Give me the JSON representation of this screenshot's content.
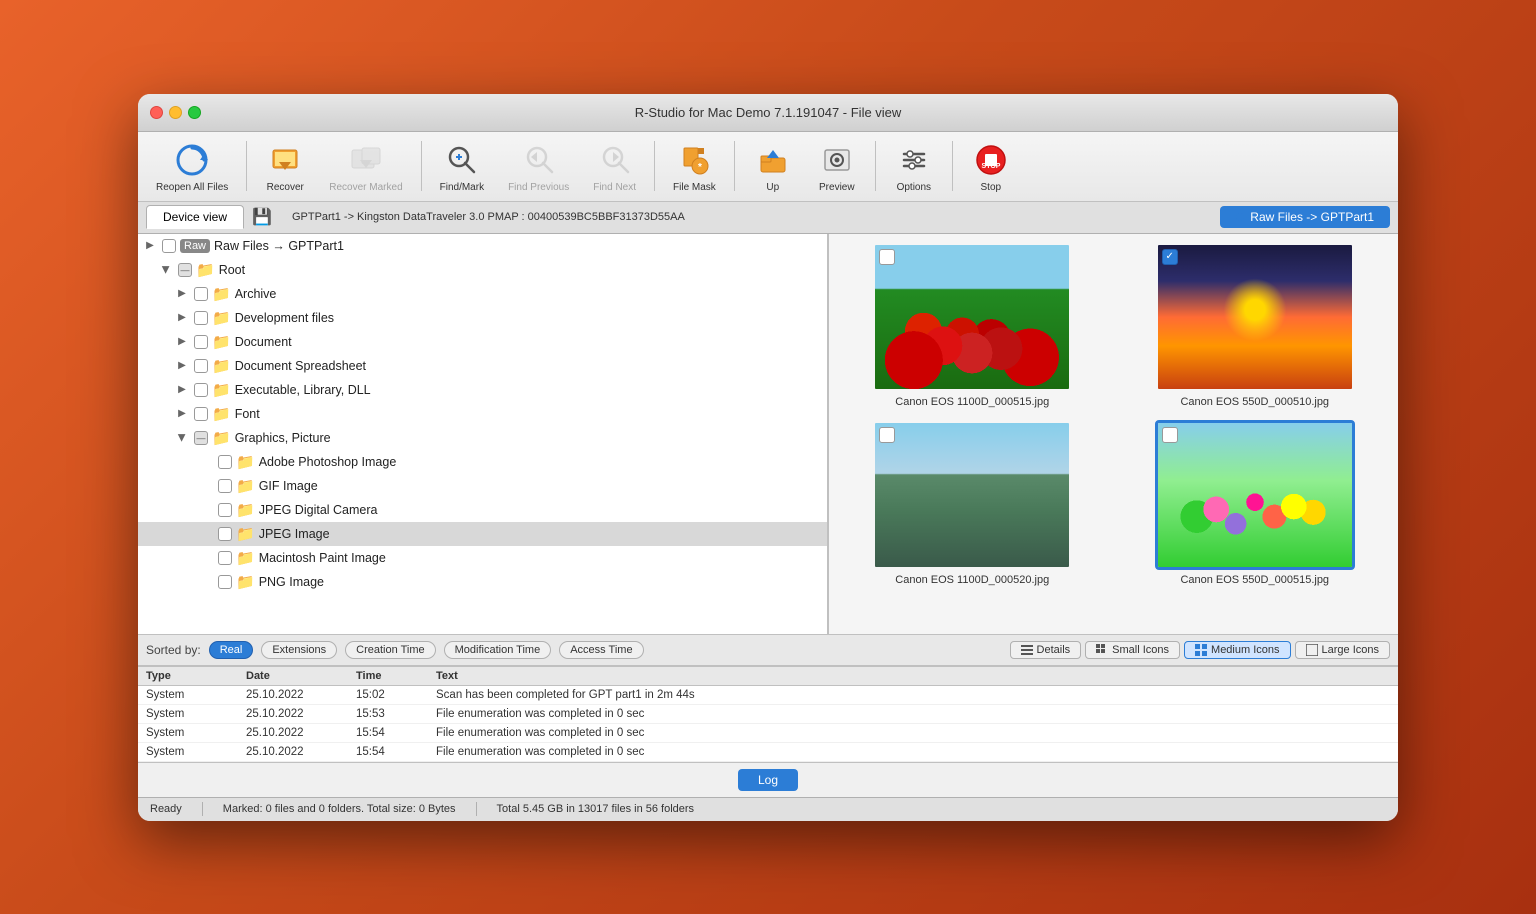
{
  "window": {
    "title": "R-Studio for Mac Demo 7.1.191047 - File view"
  },
  "titlebar": {
    "title": "R-Studio for Mac Demo 7.1.191047 - File view"
  },
  "toolbar": {
    "buttons": [
      {
        "id": "reopen-all-files",
        "label": "Reopen All Files",
        "icon": "↺",
        "disabled": false
      },
      {
        "id": "recover",
        "label": "Recover",
        "icon": "📤",
        "disabled": false
      },
      {
        "id": "recover-marked",
        "label": "Recover Marked",
        "icon": "📦",
        "disabled": false
      },
      {
        "id": "find-mark",
        "label": "Find/Mark",
        "icon": "🔍",
        "disabled": false
      },
      {
        "id": "find-previous",
        "label": "Find Previous",
        "icon": "🔍",
        "disabled": false
      },
      {
        "id": "find-next",
        "label": "Find Next",
        "icon": "🔍",
        "disabled": false
      },
      {
        "id": "file-mask",
        "label": "File Mask",
        "icon": "🎭",
        "disabled": false
      },
      {
        "id": "up",
        "label": "Up",
        "icon": "📂",
        "disabled": false
      },
      {
        "id": "preview",
        "label": "Preview",
        "icon": "👁",
        "disabled": false
      },
      {
        "id": "options",
        "label": "Options",
        "icon": "⚙",
        "disabled": false
      },
      {
        "id": "stop",
        "label": "Stop",
        "icon": "🛑",
        "disabled": false
      }
    ]
  },
  "tabbar": {
    "device_view_label": "Device view",
    "breadcrumb": "GPTPart1 -> Kingston DataTraveler 3.0 PMAP : 00400539BC5BBF31373D55AA",
    "raw_files_tab": "Raw Files -> GPTPart1"
  },
  "sidebar": {
    "root_label": "Raw Files → GPTPart1",
    "tree_items": [
      {
        "id": "root",
        "label": "Root",
        "level": 1,
        "expanded": true,
        "checked": false,
        "indeterminate": true
      },
      {
        "id": "archive",
        "label": "Archive",
        "level": 2,
        "expanded": false,
        "checked": false
      },
      {
        "id": "development-files",
        "label": "Development files",
        "level": 2,
        "expanded": false,
        "checked": false
      },
      {
        "id": "document",
        "label": "Document",
        "level": 2,
        "expanded": false,
        "checked": false
      },
      {
        "id": "document-spreadsheet",
        "label": "Document Spreadsheet",
        "level": 2,
        "expanded": false,
        "checked": false
      },
      {
        "id": "executable-library-dll",
        "label": "Executable, Library, DLL",
        "level": 2,
        "expanded": false,
        "checked": false
      },
      {
        "id": "font",
        "label": "Font",
        "level": 2,
        "expanded": false,
        "checked": false
      },
      {
        "id": "graphics-picture",
        "label": "Graphics, Picture",
        "level": 2,
        "expanded": true,
        "checked": false,
        "indeterminate": true
      },
      {
        "id": "adobe-photoshop-image",
        "label": "Adobe Photoshop Image",
        "level": 3,
        "checked": false
      },
      {
        "id": "gif-image",
        "label": "GIF Image",
        "level": 3,
        "checked": false
      },
      {
        "id": "jpeg-digital-camera",
        "label": "JPEG Digital Camera",
        "level": 3,
        "checked": false
      },
      {
        "id": "jpeg-image",
        "label": "JPEG Image",
        "level": 3,
        "checked": false,
        "selected": true
      },
      {
        "id": "macintosh-paint-image",
        "label": "Macintosh Paint Image",
        "level": 3,
        "checked": false
      },
      {
        "id": "png-image",
        "label": "PNG Image",
        "level": 3,
        "checked": false
      }
    ]
  },
  "thumbnails": [
    {
      "id": "thumb-1",
      "name": "Canon EOS 1100D_000515.jpg",
      "selected": false,
      "checked": false,
      "photo_class": "photo-tulips"
    },
    {
      "id": "thumb-2",
      "name": "Canon EOS 550D_000510.jpg",
      "selected": false,
      "checked": true,
      "photo_class": "photo-sunset"
    },
    {
      "id": "thumb-3",
      "name": "Canon EOS 1100D_000520.jpg",
      "selected": false,
      "checked": false,
      "photo_class": "photo-dock"
    },
    {
      "id": "thumb-4",
      "name": "Canon EOS 550D_000515.jpg",
      "selected": true,
      "checked": true,
      "photo_class": "photo-flowers"
    }
  ],
  "sortbar": {
    "label": "Sorted by:",
    "options": [
      "Real",
      "Extensions",
      "Creation Time",
      "Modification Time",
      "Access Time"
    ],
    "active": "Real",
    "view_options": [
      "Details",
      "Small Icons",
      "Medium Icons",
      "Large Icons"
    ],
    "active_view": "Medium Icons"
  },
  "log_table": {
    "headers": [
      "Type",
      "Date",
      "Time",
      "Text"
    ],
    "rows": [
      {
        "type": "System",
        "date": "25.10.2022",
        "time": "15:02",
        "text": "Scan has been completed for GPT part1 in 2m 44s"
      },
      {
        "type": "System",
        "date": "25.10.2022",
        "time": "15:53",
        "text": "File enumeration was completed in 0 sec"
      },
      {
        "type": "System",
        "date": "25.10.2022",
        "time": "15:54",
        "text": "File enumeration was completed in 0 sec"
      },
      {
        "type": "System",
        "date": "25.10.2022",
        "time": "15:54",
        "text": "File enumeration was completed in 0 sec"
      }
    ],
    "log_button": "Log"
  },
  "statusbar": {
    "ready_label": "Ready",
    "marked_info": "Marked: 0 files and 0 folders. Total size: 0 Bytes",
    "total_info": "Total 5.45 GB in 13017 files in 56 folders"
  }
}
